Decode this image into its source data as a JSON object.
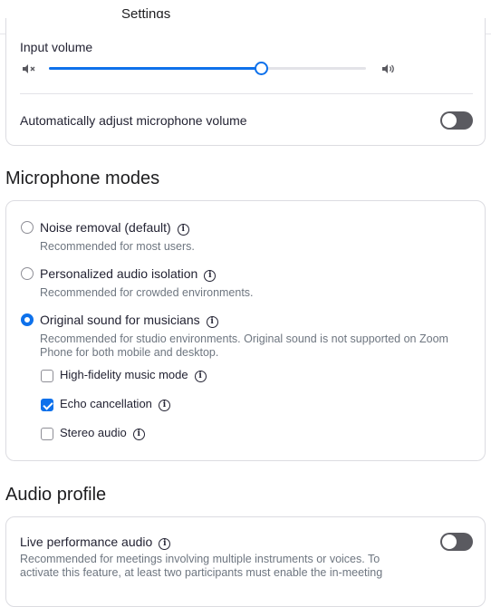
{
  "window": {
    "title": "Settings"
  },
  "input_volume": {
    "label": "Input volume",
    "level_percent": 67,
    "auto_adjust_label": "Automatically adjust microphone volume",
    "auto_adjust_on": false
  },
  "microphone_modes": {
    "heading": "Microphone modes",
    "options": [
      {
        "label": "Noise removal (default)",
        "desc": "Recommended for most users.",
        "selected": false
      },
      {
        "label": "Personalized audio isolation",
        "desc": "Recommended for crowded environments.",
        "selected": false
      },
      {
        "label": "Original sound for musicians",
        "desc": "Recommended for studio environments. Original sound is not supported on Zoom Phone for both mobile and desktop.",
        "selected": true
      }
    ],
    "sub_options": [
      {
        "label": "High-fidelity music mode",
        "checked": false
      },
      {
        "label": "Echo cancellation",
        "checked": true
      },
      {
        "label": "Stereo audio",
        "checked": false
      }
    ]
  },
  "audio_profile": {
    "heading": "Audio profile",
    "live_label": "Live performance audio",
    "live_desc": "Recommended for meetings involving multiple instruments or voices. To activate this feature, at least two participants must enable the in-meeting",
    "live_on": false
  },
  "icons": {
    "info": "i",
    "speaker_mute": "speaker-mute-icon",
    "speaker_loud": "speaker-loud-icon"
  },
  "colors": {
    "accent": "#0e71eb",
    "toggle_off": "#5a5a60"
  }
}
